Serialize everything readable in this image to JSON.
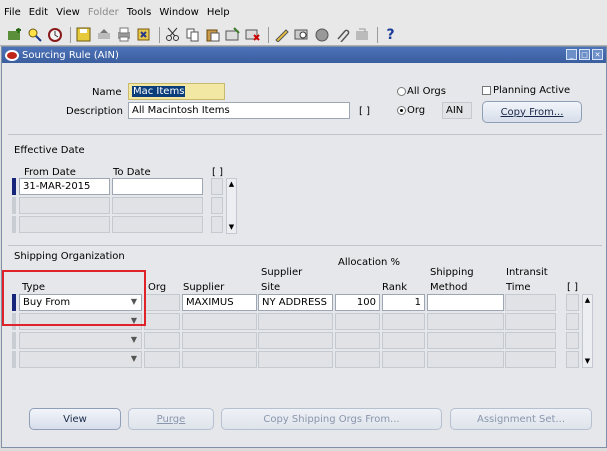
{
  "menubar": {
    "items": [
      {
        "label": "File",
        "enabled": true
      },
      {
        "label": "Edit",
        "enabled": true
      },
      {
        "label": "View",
        "enabled": true
      },
      {
        "label": "Folder",
        "enabled": false
      },
      {
        "label": "Tools",
        "enabled": true
      },
      {
        "label": "Window",
        "enabled": true
      },
      {
        "label": "Help",
        "enabled": true
      }
    ]
  },
  "toolbar": {
    "icons": [
      "new-icon",
      "find-icon",
      "navigator-icon",
      "save-icon",
      "next-step-icon",
      "print-icon",
      "close-form-icon",
      "cut-icon",
      "copy-icon",
      "paste-icon",
      "new-record-icon",
      "delete-record-icon",
      "edit-field-icon",
      "zoom-icon",
      "translations-icon",
      "attachments-icon",
      "folder-tools-icon",
      "help-icon"
    ],
    "help_glyph": "?"
  },
  "window": {
    "title": "Sourcing Rule (AIN)"
  },
  "header": {
    "name_label": "Name",
    "name_value": "Mac Items",
    "description_label": "Description",
    "description_value": "All Macintosh Items",
    "desc_flex_brackets": "[ ]",
    "all_orgs_label": "All Orgs",
    "org_label": "Org",
    "org_value": "AIN",
    "planning_active_label": "Planning Active",
    "copy_from_label": "Copy From..."
  },
  "effective_date": {
    "section_title": "Effective Date",
    "from_date_header": "From Date",
    "to_date_header": "To Date",
    "flex_brackets": "[ ]",
    "rows": [
      {
        "from": "31-MAR-2015",
        "to": ""
      },
      {
        "from": "",
        "to": ""
      },
      {
        "from": "",
        "to": ""
      }
    ]
  },
  "shipping": {
    "section_title": "Shipping Organization",
    "headers": {
      "type": "Type",
      "org": "Org",
      "supplier": "Supplier",
      "supplier_site_line1": "Supplier",
      "supplier_site_line2": "Site",
      "allocation": "Allocation %",
      "rank": "Rank",
      "shipping_method_line1": "Shipping",
      "shipping_method_line2": "Method",
      "intransit_line1": "Intransit",
      "intransit_line2": "Time",
      "flex_brackets": "[ ]"
    },
    "rows": [
      {
        "type": "Buy From",
        "org": "",
        "supplier": "MAXIMUS",
        "site": "NY ADDRESS",
        "allocation": "100",
        "rank": "1",
        "method": "",
        "intransit": ""
      },
      {
        "type": "",
        "org": "",
        "supplier": "",
        "site": "",
        "allocation": "",
        "rank": "",
        "method": "",
        "intransit": ""
      },
      {
        "type": "",
        "org": "",
        "supplier": "",
        "site": "",
        "allocation": "",
        "rank": "",
        "method": "",
        "intransit": ""
      },
      {
        "type": "",
        "org": "",
        "supplier": "",
        "site": "",
        "allocation": "",
        "rank": "",
        "method": "",
        "intransit": ""
      }
    ]
  },
  "buttons": {
    "view": "View",
    "purge": "Purge",
    "copy_shipping": "Copy Shipping Orgs From...",
    "assignment_set": "Assignment Set..."
  },
  "annotation": {
    "highlight_color": "#e0222a"
  }
}
